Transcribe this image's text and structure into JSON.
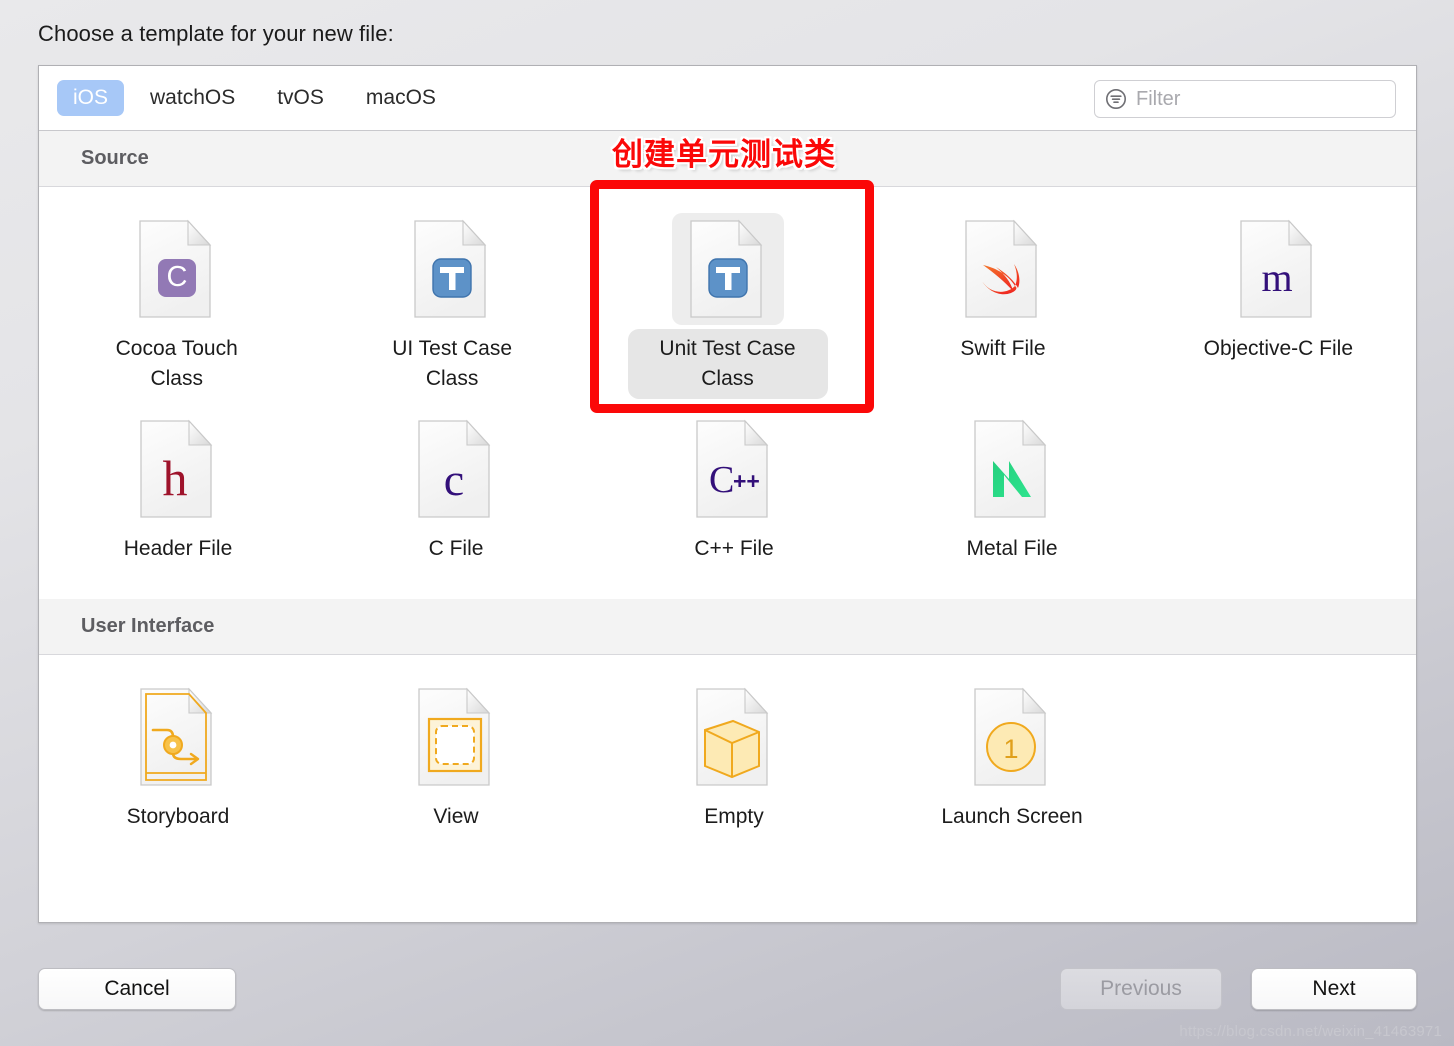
{
  "dialog": {
    "title": "Choose a template for your new file:"
  },
  "platform_tabs": [
    {
      "label": "iOS",
      "selected": true
    },
    {
      "label": "watchOS",
      "selected": false
    },
    {
      "label": "tvOS",
      "selected": false
    },
    {
      "label": "macOS",
      "selected": false
    }
  ],
  "filter": {
    "placeholder": "Filter",
    "value": "",
    "icon": "filter-icon"
  },
  "annotation": {
    "text": "创建单元测试类",
    "color": "#fb0808",
    "outline_color": "#ffffff",
    "target": "Unit Test Case Class"
  },
  "sections": [
    {
      "title": "Source",
      "rows": [
        [
          {
            "label": "Cocoa Touch\nClass",
            "label_line1": "Cocoa Touch",
            "label_line2": "Class",
            "icon": "cocoa-touch-class-icon",
            "selected": false
          },
          {
            "label": "UI Test Case\nClass",
            "label_line1": "UI Test Case",
            "label_line2": "Class",
            "icon": "ui-test-case-class-icon",
            "selected": false
          },
          {
            "label": "Unit Test Case\nClass",
            "label_line1": "Unit Test Case",
            "label_line2": "Class",
            "icon": "unit-test-case-class-icon",
            "selected": true
          },
          {
            "label": "Swift File",
            "label_line1": "Swift File",
            "label_line2": "",
            "icon": "swift-file-icon",
            "selected": false
          },
          {
            "label": "Objective-C File",
            "label_line1": "Objective-C File",
            "label_line2": "",
            "icon": "objective-c-file-icon",
            "selected": false
          }
        ],
        [
          {
            "label": "Header File",
            "label_line1": "Header File",
            "label_line2": "",
            "icon": "header-file-icon",
            "selected": false
          },
          {
            "label": "C File",
            "label_line1": "C File",
            "label_line2": "",
            "icon": "c-file-icon",
            "selected": false
          },
          {
            "label": "C++ File",
            "label_line1": "C++ File",
            "label_line2": "",
            "icon": "cpp-file-icon",
            "selected": false
          },
          {
            "label": "Metal File",
            "label_line1": "Metal File",
            "label_line2": "",
            "icon": "metal-file-icon",
            "selected": false
          }
        ]
      ]
    },
    {
      "title": "User Interface",
      "rows": [
        [
          {
            "label": "Storyboard",
            "label_line1": "Storyboard",
            "label_line2": "",
            "icon": "storyboard-icon",
            "selected": false
          },
          {
            "label": "View",
            "label_line1": "View",
            "label_line2": "",
            "icon": "view-icon",
            "selected": false
          },
          {
            "label": "Empty",
            "label_line1": "Empty",
            "label_line2": "",
            "icon": "empty-icon",
            "selected": false
          },
          {
            "label": "Launch Screen",
            "label_line1": "Launch Screen",
            "label_line2": "",
            "icon": "launch-screen-icon",
            "selected": false
          }
        ]
      ]
    }
  ],
  "buttons": {
    "cancel": "Cancel",
    "previous": "Previous",
    "next": "Next"
  },
  "watermark": "https://blog.csdn.net/weixin_41463971"
}
